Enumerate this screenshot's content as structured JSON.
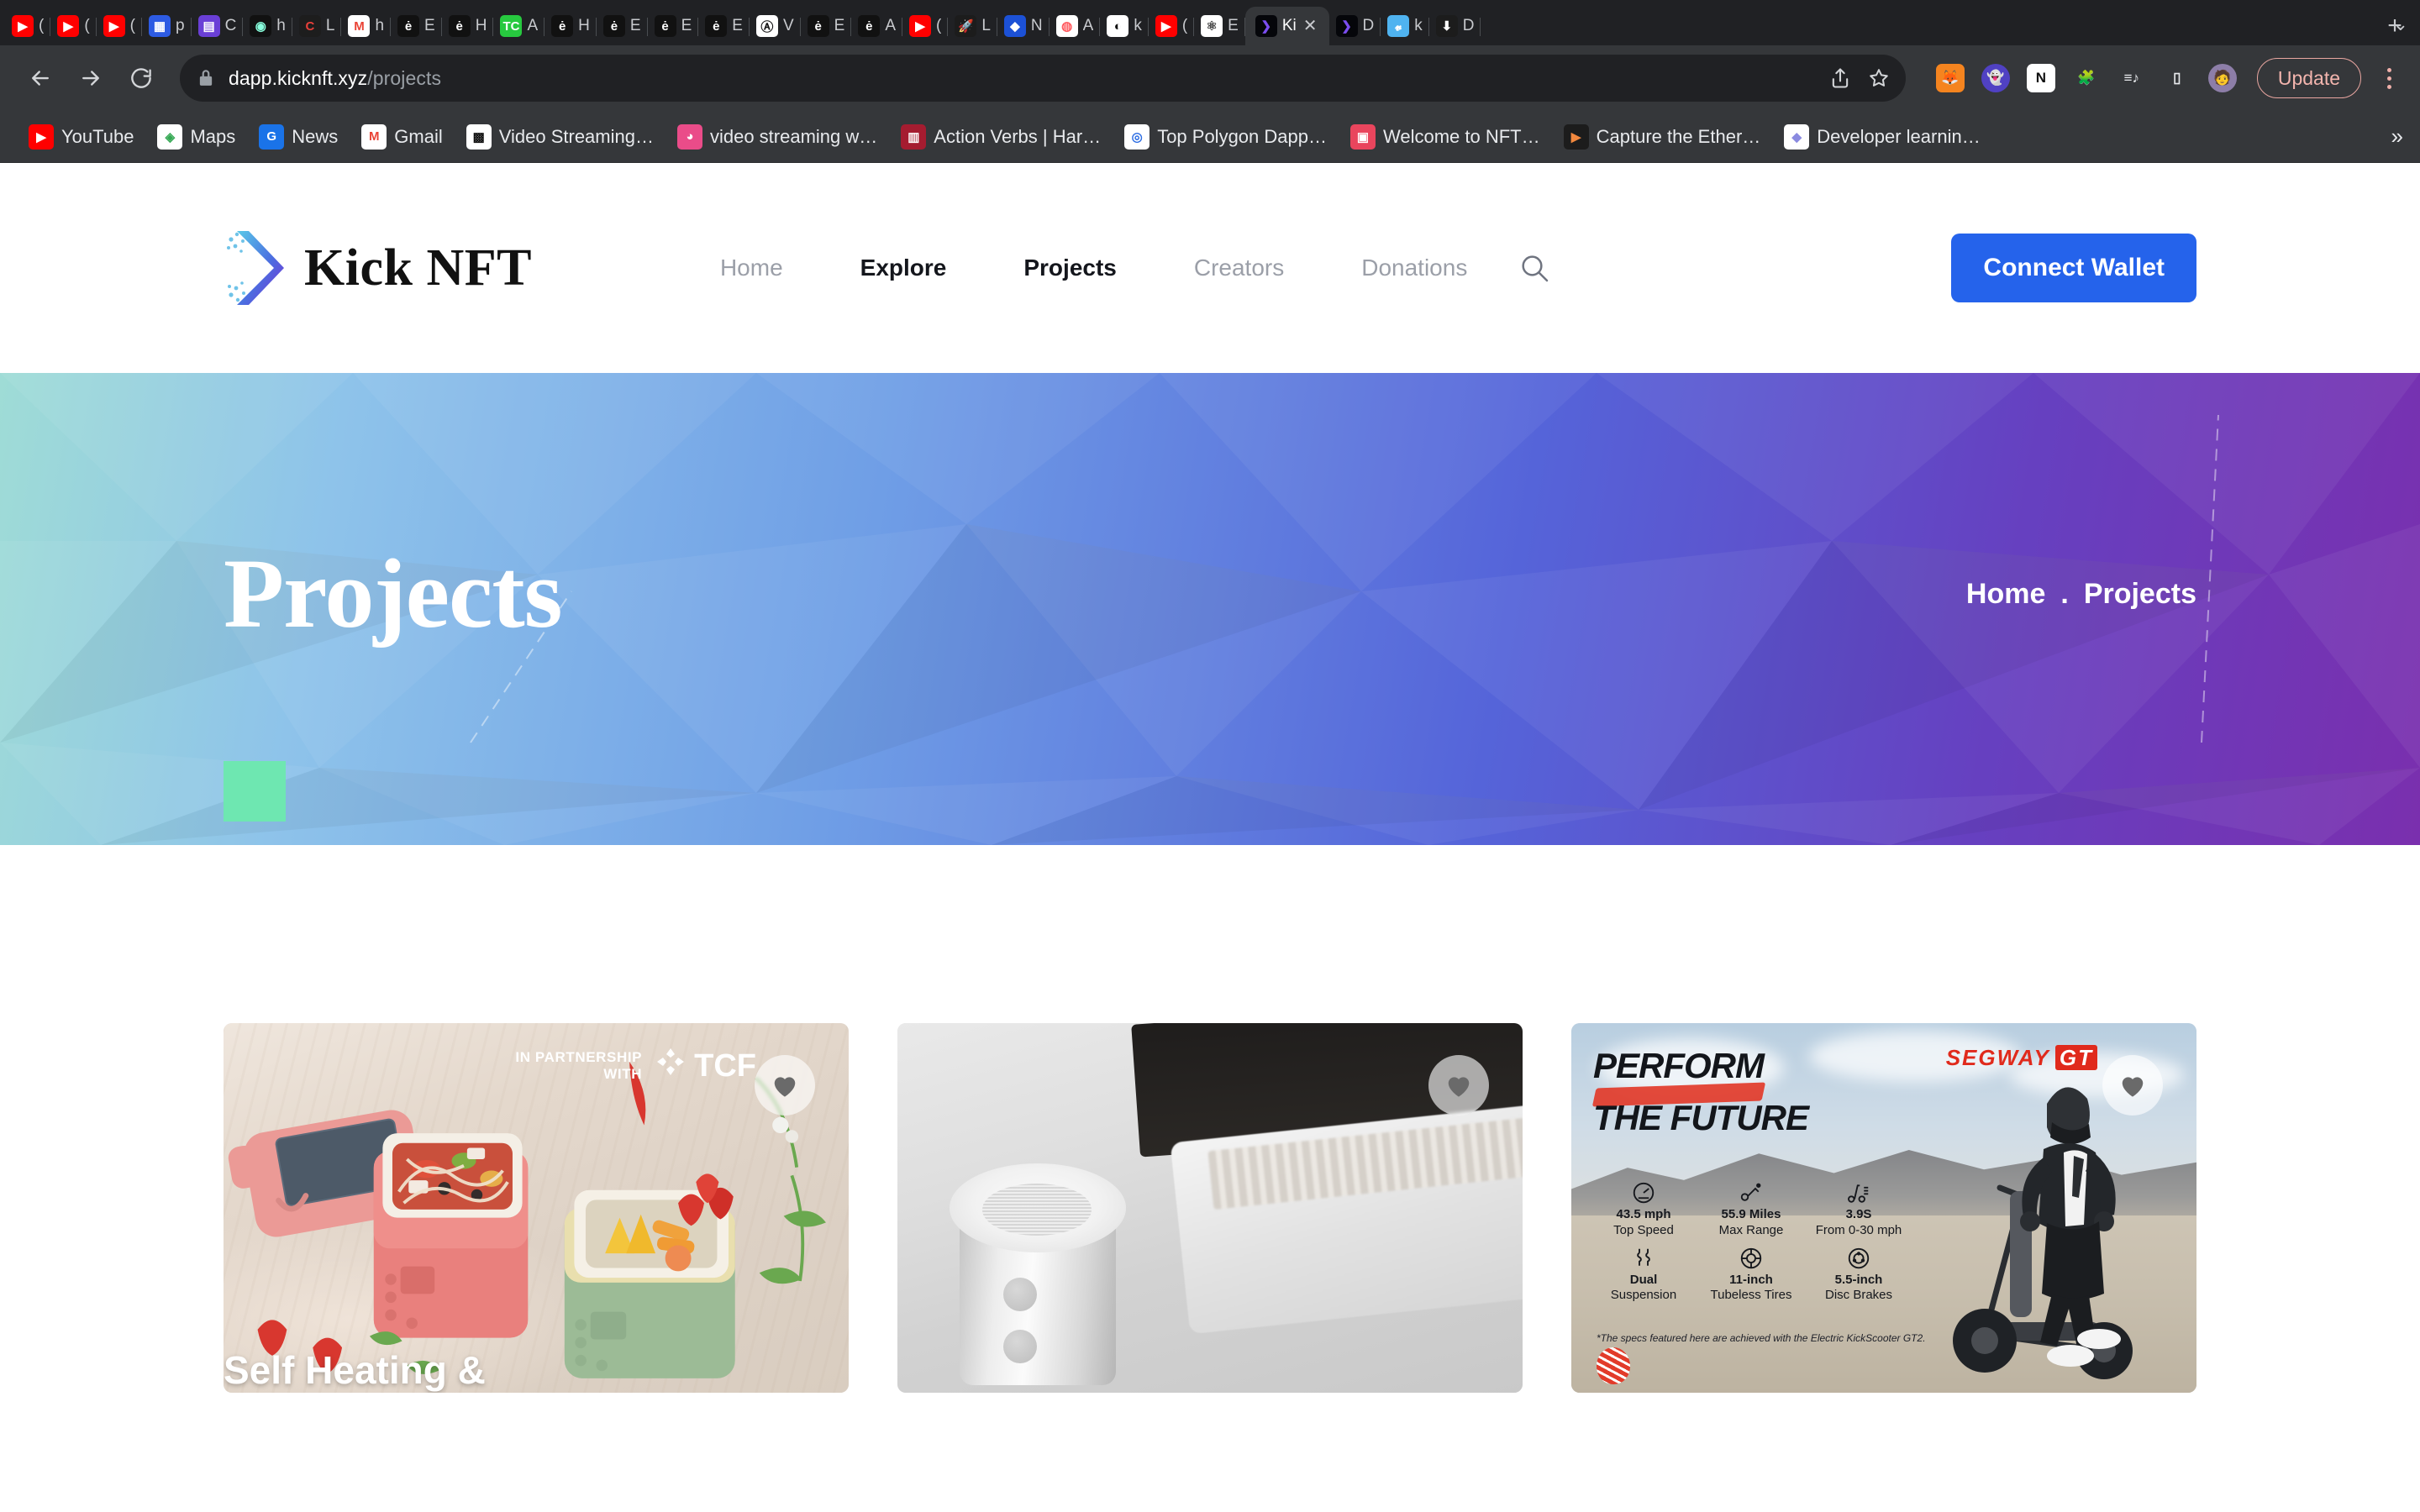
{
  "browser": {
    "tabs": [
      {
        "title": "(",
        "fav": "youtube"
      },
      {
        "title": "(",
        "fav": "youtube"
      },
      {
        "title": "(",
        "fav": "youtube"
      },
      {
        "title": "p",
        "fav": "tableau"
      },
      {
        "title": "C",
        "fav": "coda"
      },
      {
        "title": "h",
        "fav": "orb"
      },
      {
        "title": "L",
        "fav": "c-red"
      },
      {
        "title": "h",
        "fav": "gmail"
      },
      {
        "title": "E",
        "fav": "eth"
      },
      {
        "title": "H",
        "fav": "eth"
      },
      {
        "title": "A",
        "fav": "tc"
      },
      {
        "title": "H",
        "fav": "eth"
      },
      {
        "title": "E",
        "fav": "eth"
      },
      {
        "title": "E",
        "fav": "eth"
      },
      {
        "title": "E",
        "fav": "eth"
      },
      {
        "title": "V",
        "fav": "avax"
      },
      {
        "title": "E",
        "fav": "eth"
      },
      {
        "title": "A",
        "fav": "eth"
      },
      {
        "title": "(",
        "fav": "youtube"
      },
      {
        "title": "L",
        "fav": "rocket"
      },
      {
        "title": "N",
        "fav": "moralis"
      },
      {
        "title": "A",
        "fav": "airbnb"
      },
      {
        "title": "k",
        "fav": "github"
      },
      {
        "title": "(",
        "fav": "youtube"
      },
      {
        "title": "E",
        "fav": "ethatom"
      },
      {
        "title": "Ki",
        "fav": "kicknft",
        "active": true
      },
      {
        "title": "D",
        "fav": "kicknft"
      },
      {
        "title": "k",
        "fav": "vimeo"
      },
      {
        "title": "D",
        "fav": "download"
      }
    ],
    "new_tab_label": "+",
    "tab_list_chevron": "⌄",
    "back_label": "Back",
    "forward_label": "Forward",
    "reload_label": "Reload",
    "url_host": "dapp.kicknft.xyz",
    "url_path": "/projects",
    "share_label": "Share",
    "bookmark_label": "Bookmark this tab",
    "extensions": [
      {
        "name": "metamask-extension",
        "glyph": "🦊"
      },
      {
        "name": "phantom-extension",
        "glyph": "👻"
      },
      {
        "name": "notion-extension",
        "glyph": "N"
      },
      {
        "name": "extensions-puzzle",
        "glyph": "🧩"
      },
      {
        "name": "reading-list",
        "glyph": "≡♪"
      },
      {
        "name": "device-toolbar",
        "glyph": "▯"
      },
      {
        "name": "profile-avatar",
        "glyph": "🧑"
      }
    ],
    "update_label": "Update",
    "bookmarks": [
      {
        "label": "YouTube",
        "fav": "youtube"
      },
      {
        "label": "Maps",
        "fav": "maps"
      },
      {
        "label": "News",
        "fav": "news"
      },
      {
        "label": "Gmail",
        "fav": "gmail"
      },
      {
        "label": "Video Streaming…",
        "fav": "smart"
      },
      {
        "label": "video streaming w…",
        "fav": "dribbble"
      },
      {
        "label": "Action Verbs | Har…",
        "fav": "harvard"
      },
      {
        "label": "Top Polygon Dapp…",
        "fav": "polygon"
      },
      {
        "label": "Welcome to NFT…",
        "fav": "nft"
      },
      {
        "label": "Capture the Ether…",
        "fav": "ctf"
      },
      {
        "label": "Developer learnin…",
        "fav": "ethdev"
      }
    ],
    "bookmarks_overflow": "»"
  },
  "site": {
    "brand": "Kick NFT",
    "nav": [
      {
        "label": "Home",
        "state": "muted"
      },
      {
        "label": "Explore",
        "state": "strong"
      },
      {
        "label": "Projects",
        "state": "active"
      },
      {
        "label": "Creators",
        "state": "muted"
      },
      {
        "label": "Donations",
        "state": "muted"
      }
    ],
    "search_label": "Search",
    "connect_wallet": "Connect Wallet",
    "hero": {
      "title": "Projects",
      "breadcrumb_home": "Home",
      "breadcrumb_separator": ".",
      "breadcrumb_current": "Projects",
      "accent_color": "#6EE7B1"
    },
    "cards": [
      {
        "name": "self-heating-lunchbox",
        "title": "Self Heating &",
        "partnership_line1": "IN PARTNERSHIP",
        "partnership_line2": "WITH",
        "partner_brand": "TCF",
        "favorite_label": "Add to favorites"
      },
      {
        "name": "bluetooth-speaker",
        "title": "",
        "favorite_label": "Add to favorites"
      },
      {
        "name": "segway-gt",
        "title": "",
        "headline_line1": "PERFORM",
        "headline_line2": "THE FUTURE",
        "brand": "SEGWAY",
        "brand_suffix": "GT",
        "specs": [
          {
            "icon": "speedometer-icon",
            "value": "43.5 mph",
            "label": "Top Speed"
          },
          {
            "icon": "range-icon",
            "value": "55.9 Miles",
            "label": "Max Range"
          },
          {
            "icon": "scooter-icon",
            "value": "3.9S",
            "label": "From 0-30 mph"
          },
          {
            "icon": "suspension-icon",
            "value": "Dual",
            "label": "Suspension"
          },
          {
            "icon": "tire-icon",
            "value": "11-inch",
            "label": "Tubeless Tires"
          },
          {
            "icon": "brake-icon",
            "value": "5.5-inch",
            "label": "Disc Brakes"
          }
        ],
        "footnote": "*The specs featured here are achieved with the Electric KickScooter GT2.",
        "favorite_label": "Add to favorites"
      }
    ]
  }
}
